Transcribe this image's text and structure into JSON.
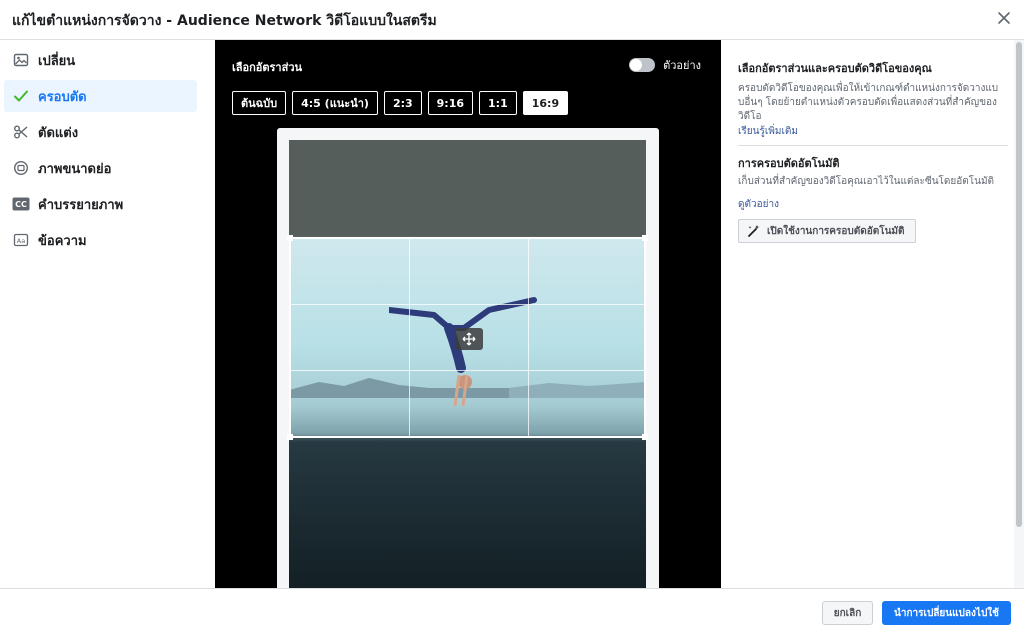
{
  "header": {
    "title": "แก้ไขตำแหน่งการจัดวาง - Audience Network วิดีโอแบบในสตรีม"
  },
  "sidebar": {
    "items": [
      {
        "label": "เปลี่ยน",
        "icon": "image-icon"
      },
      {
        "label": "ครอบตัด",
        "icon": "check-icon",
        "active": true
      },
      {
        "label": "ตัดแต่ง",
        "icon": "scissors-icon"
      },
      {
        "label": "ภาพขนาดย่อ",
        "icon": "thumbnail-icon"
      },
      {
        "label": "คำบรรยายภาพ",
        "icon": "cc-icon"
      },
      {
        "label": "ข้อความ",
        "icon": "text-icon"
      }
    ]
  },
  "editor": {
    "ratio_title": "เลือกอัตราส่วน",
    "preview_label": "ตัวอย่าง",
    "ratios": [
      "ต้นฉบับ",
      "4:5 (แนะนำ)",
      "2:3",
      "9:16",
      "1:1",
      "16:9"
    ],
    "selected_ratio": "16:9"
  },
  "right_panel": {
    "title": "เลือกอัตราส่วนและครอบตัดวิดีโอของคุณ",
    "description": "ครอบตัดวิดีโอของคุณเพื่อให้เข้าเกณฑ์ตำแหน่งการจัดวางแบบอื่นๆ โดยย้ายตำแหน่งตัวครอบตัดเพื่อแสดงส่วนที่สำคัญของวิดีโอ",
    "learn_more": "เรียนรู้เพิ่มเติม",
    "auto_title": "การครอบตัดอัตโนมัติ",
    "auto_desc": "เก็บส่วนที่สำคัญของวิดีโอคุณเอาไว้ในแต่ละซีนโดยอัตโนมัติ",
    "see_example": "ดูตัวอย่าง",
    "auto_button": "เปิดใช้งานการครอบตัดอัตโนมัติ"
  },
  "footer": {
    "cancel": "ยกเลิก",
    "apply": "นำการเปลี่ยนแปลงไปใช้"
  },
  "colors": {
    "accent": "#1877f2",
    "editor_bg": "#000000"
  }
}
